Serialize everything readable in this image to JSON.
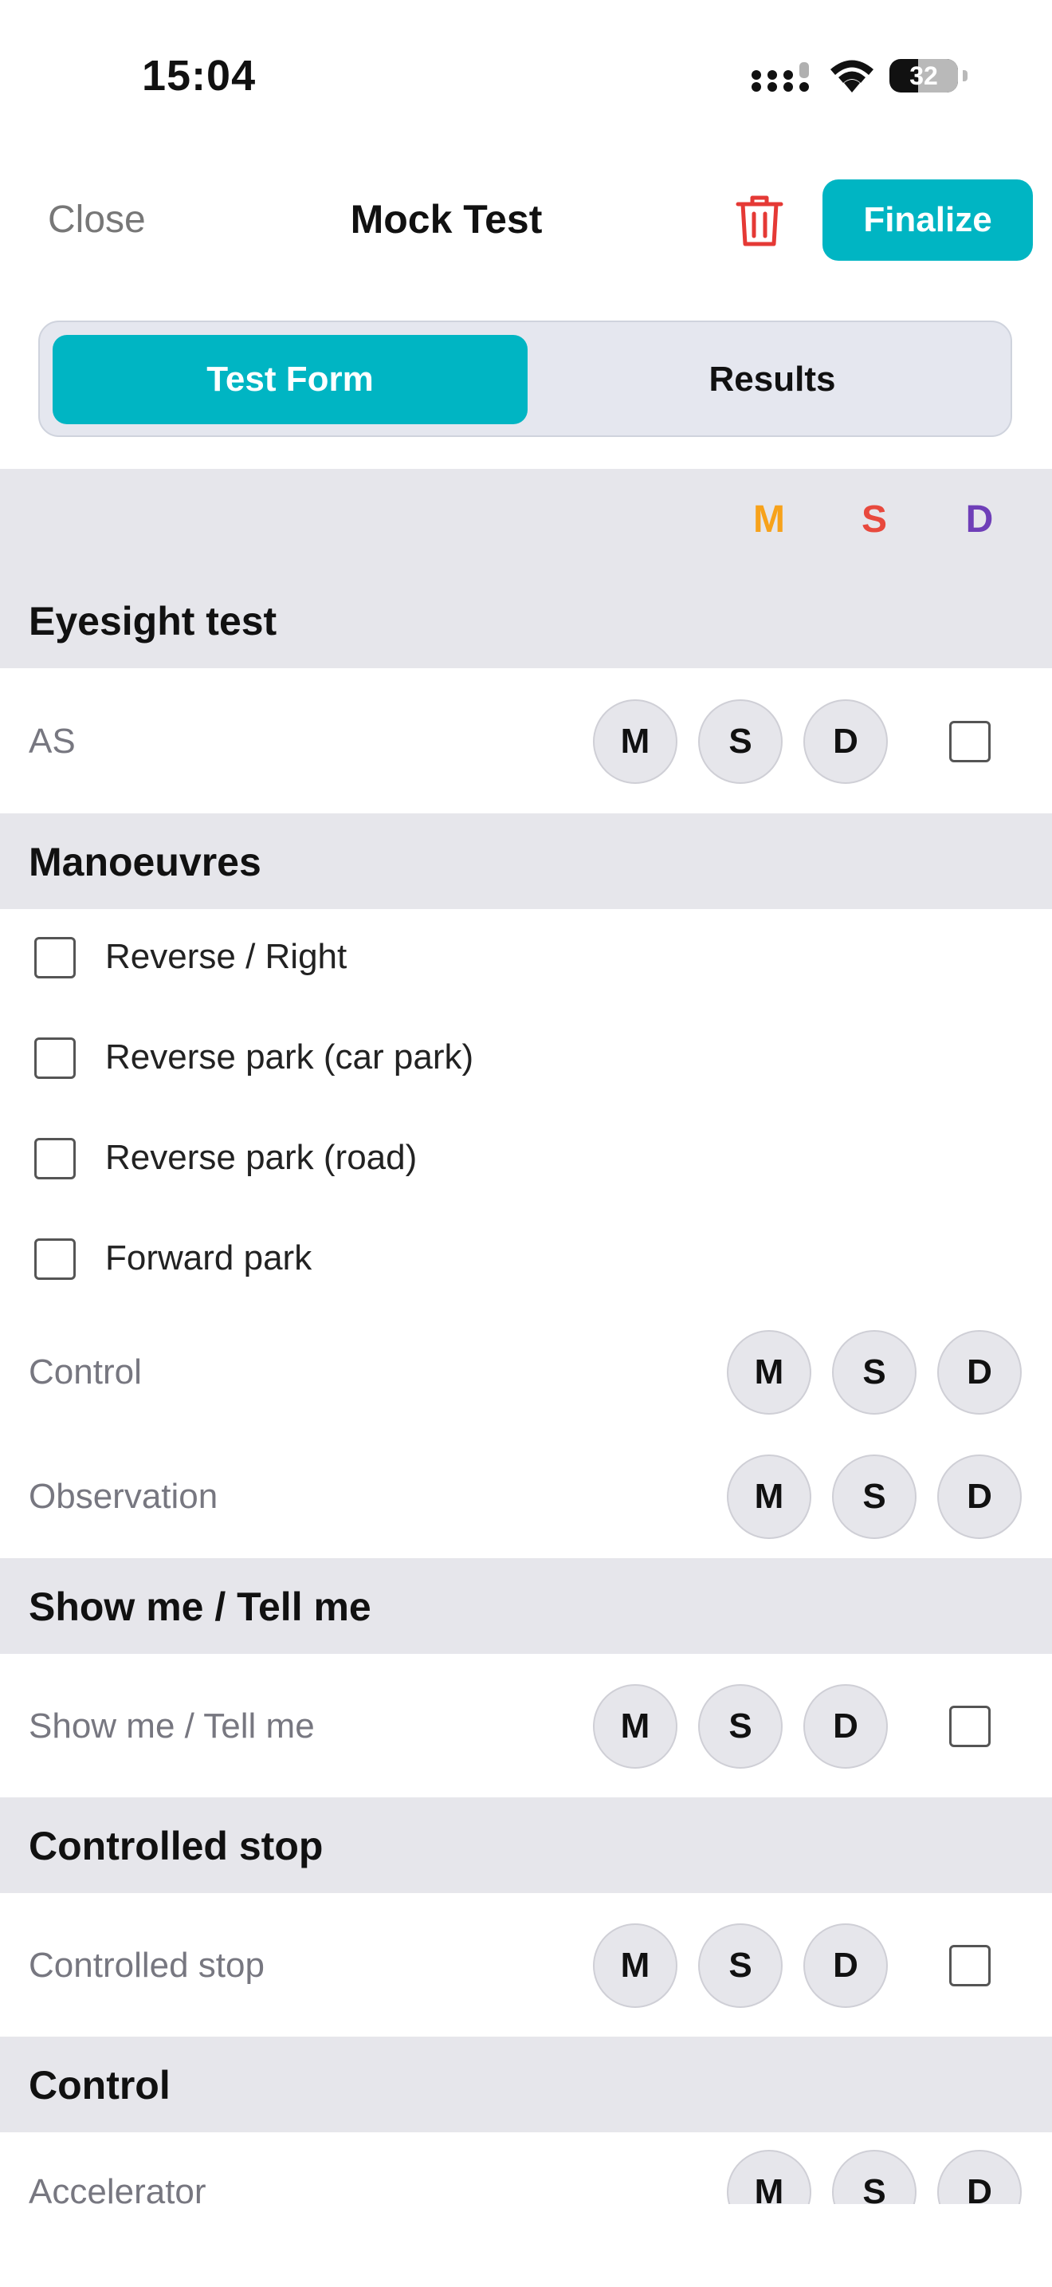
{
  "status_bar": {
    "time": "15:04",
    "battery": "32"
  },
  "header": {
    "close_label": "Close",
    "title": "Mock Test",
    "finalize_label": "Finalize"
  },
  "tabs": {
    "active": "Test Form",
    "inactive": "Results"
  },
  "legend": {
    "m": "M",
    "s": "S",
    "d": "D"
  },
  "colors": {
    "accent": "#00b5c3",
    "m": "#f7a21b",
    "s": "#e8493d",
    "d": "#6f3fb8",
    "danger": "#e53935"
  },
  "sections": {
    "eyesight": {
      "title": "Eyesight test",
      "row": "AS"
    },
    "manoeuvres": {
      "title": "Manoeuvres",
      "options": [
        "Reverse / Right",
        "Reverse park (car park)",
        "Reverse park (road)",
        "Forward park"
      ],
      "rows": [
        "Control",
        "Observation"
      ]
    },
    "showme": {
      "title": "Show me / Tell me",
      "row": "Show me / Tell me"
    },
    "controlled_stop": {
      "title": "Controlled stop",
      "row": "Controlled stop"
    },
    "control": {
      "title": "Control",
      "row": "Accelerator"
    }
  },
  "buttons": {
    "m": "M",
    "s": "S",
    "d": "D"
  },
  "icons": [
    "signal-icon",
    "wifi-icon",
    "battery-icon",
    "trash-icon"
  ]
}
